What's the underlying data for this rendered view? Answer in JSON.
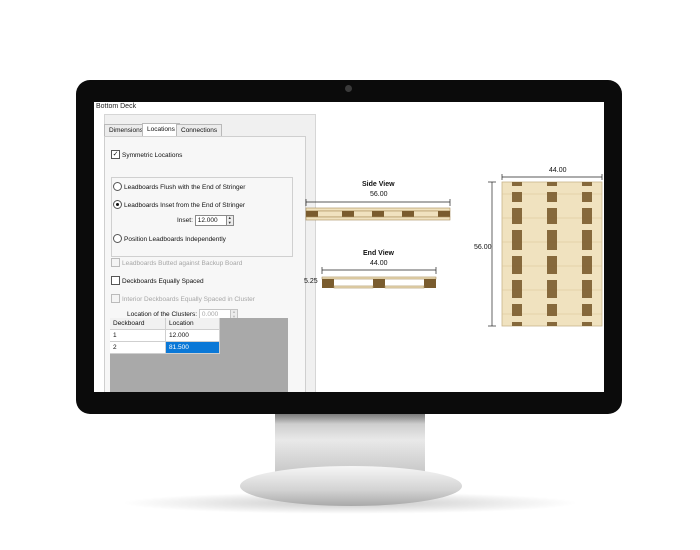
{
  "dialog": {
    "title": "Bottom Deck",
    "tabs": [
      {
        "label": "Dimensions",
        "active": false
      },
      {
        "label": "Locations",
        "active": true
      },
      {
        "label": "Connections",
        "active": false
      }
    ],
    "symmetric_locations": {
      "label": "Symmetric Locations",
      "checked": true
    },
    "placement_options": [
      {
        "label": "Leadboards Flush with the End of  Stringer",
        "selected": false
      },
      {
        "label": "Leadboards Inset from the End of Stringer",
        "selected": true
      },
      {
        "label": "Position Leadboards Independently",
        "selected": false
      }
    ],
    "inset": {
      "label": "Inset:",
      "value": "12.000"
    },
    "butted_backup": {
      "label": "Leadboards Butted against Backup Board",
      "checked": false,
      "enabled": false
    },
    "equally_spaced": {
      "label": "Deckboards Equally Spaced",
      "checked": false,
      "enabled": true
    },
    "interior_equally_spaced": {
      "label": "Interior Deckboards Equally Spaced in Cluster",
      "checked": false,
      "enabled": false
    },
    "cluster_location": {
      "label": "Location of the Clusters:",
      "value": "0.000",
      "enabled": false
    },
    "grid": {
      "headers": [
        "Deckboard",
        "Location"
      ],
      "rows": [
        {
          "deckboard": "1",
          "location": "12.000",
          "selected": false
        },
        {
          "deckboard": "2",
          "location": "81.500",
          "selected": true
        }
      ]
    }
  },
  "drawings": {
    "side_view": {
      "title": "Side View",
      "length": "56.00"
    },
    "end_view": {
      "title": "End View",
      "width": "44.00",
      "height": "5.25"
    },
    "top_view": {
      "width": "44.00",
      "length": "56.00"
    }
  },
  "colors": {
    "monitor_bezel": "#0b0b0b",
    "wood_light": "#f0e2bf",
    "wood_dark": "#7a5c2e",
    "selection": "#0a78d7"
  }
}
